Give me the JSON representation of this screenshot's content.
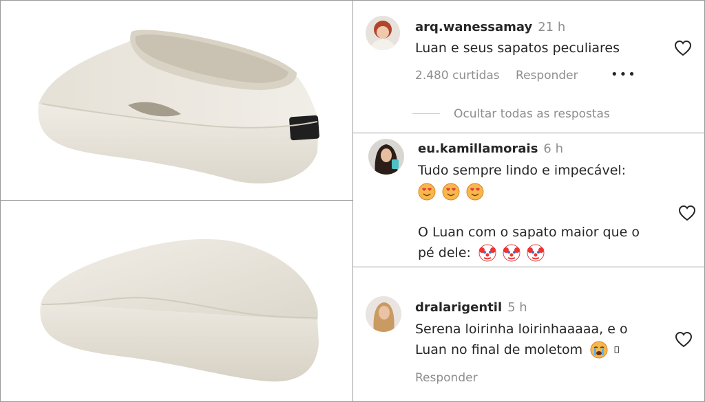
{
  "comments": [
    {
      "username": "arq.wanessamay",
      "time": "21 h",
      "text": "Luan e seus sapatos peculiares",
      "likes": "2.480 curtidas",
      "reply": "Responder",
      "more": "•••",
      "hide_replies": "Ocultar todas as respostas"
    },
    {
      "username": "eu.kamillamorais",
      "time": "6 h",
      "text_line1": "Tudo sempre lindo e impecável:",
      "text_line2": "O Luan com o sapato maior que o",
      "text_line3": "pé dele:"
    },
    {
      "username": "dralarigentil",
      "time": "5 h",
      "text_line1": "Serena loirinha loirinhaaaaa, e o",
      "text_line2": "Luan no final de moletom",
      "reply": "Responder"
    }
  ],
  "colors": {
    "text": "#262626",
    "muted": "#8e8e8e",
    "shoe": "#e9e5dc"
  }
}
